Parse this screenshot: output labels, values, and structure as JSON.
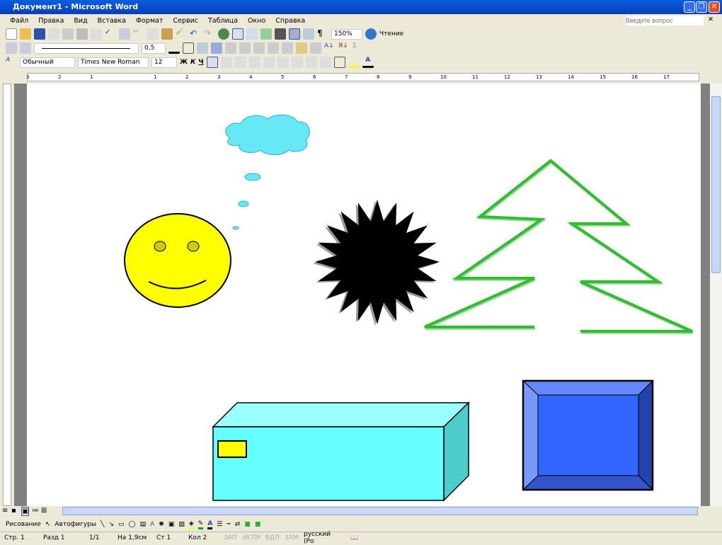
{
  "window": {
    "title": "Документ1 - Microsoft Word",
    "help_placeholder": "Введите вопрос"
  },
  "menu": [
    "Файл",
    "Правка",
    "Вид",
    "Вставка",
    "Формат",
    "Сервис",
    "Таблица",
    "Окно",
    "Справка"
  ],
  "toolbar_standard": {
    "zoom": "150%",
    "reading": "Чтение"
  },
  "toolbar_drawing_lines": {
    "line_weight": "0,5"
  },
  "toolbar_formatting": {
    "style": "Обычный",
    "font": "Times New Roman",
    "size": "12",
    "bold": "Ж",
    "italic": "К",
    "underline": "Ч"
  },
  "ruler": {
    "labels": [
      "3",
      "2",
      "1",
      "1",
      "2",
      "3",
      "4",
      "5",
      "6",
      "7",
      "8",
      "9",
      "10",
      "11",
      "12",
      "13",
      "14",
      "15",
      "16",
      "17"
    ]
  },
  "drawing_toolbar": {
    "draw": "Рисование",
    "autoshapes": "Автофигуры"
  },
  "status": {
    "page": "Стр. 1",
    "section": "Разд 1",
    "pages": "1/1",
    "at": "На 1,9см",
    "line": "Ст 1",
    "col": "Кол 2",
    "rec": "ЗАП",
    "trk": "ИСПР",
    "ext": "ВДЛ",
    "ovr": "ЗАМ",
    "lang": "русский (Ро"
  },
  "colors": {
    "cloud": "#66e8f6",
    "smiley": "#ffff00",
    "star": "#000000",
    "tree": "#33bb33",
    "box_front": "#66ffff",
    "bevel": "#3366ff"
  }
}
